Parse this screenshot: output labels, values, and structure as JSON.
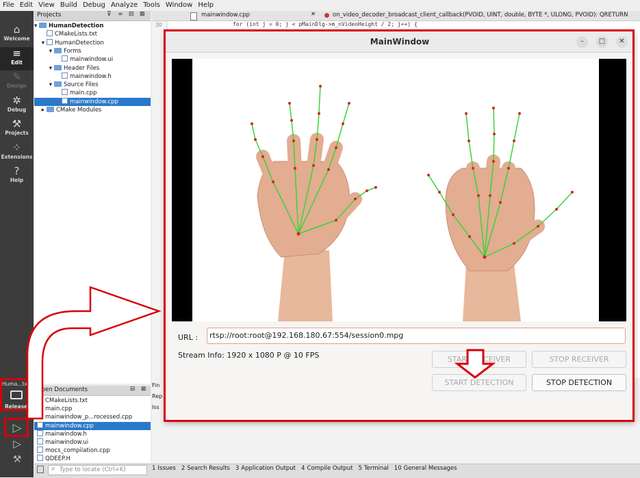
{
  "menu": [
    "File",
    "Edit",
    "View",
    "Build",
    "Debug",
    "Analyze",
    "Tools",
    "Window",
    "Help"
  ],
  "modes": [
    {
      "label": "Welcome",
      "icon": "home-icon",
      "glyph": "⌂",
      "state": "normal"
    },
    {
      "label": "Edit",
      "icon": "edit-icon",
      "glyph": "≡",
      "state": "active"
    },
    {
      "label": "Design",
      "icon": "design-icon",
      "glyph": "✎",
      "state": "disabled"
    },
    {
      "label": "Debug",
      "icon": "debug-icon",
      "glyph": "✲",
      "state": "normal"
    },
    {
      "label": "Projects",
      "icon": "projects-icon",
      "glyph": "⚒",
      "state": "normal"
    },
    {
      "label": "Extensions",
      "icon": "extensions-icon",
      "glyph": "⁘",
      "state": "normal"
    },
    {
      "label": "Help",
      "icon": "help-icon",
      "glyph": "?",
      "state": "normal"
    }
  ],
  "target": {
    "name": "Huma...txn",
    "config": "Release"
  },
  "projects": {
    "title": "Projects",
    "tree": [
      {
        "label": "HumanDetection",
        "depth": 0,
        "kind": "project",
        "bold": true,
        "arrow": "▾"
      },
      {
        "label": "CMakeLists.txt",
        "depth": 1,
        "kind": "cmake",
        "arrow": ""
      },
      {
        "label": "HumanDetection",
        "depth": 1,
        "kind": "target",
        "arrow": "▾"
      },
      {
        "label": "Forms",
        "depth": 2,
        "kind": "folder",
        "arrow": "▾"
      },
      {
        "label": "mainwindow.ui",
        "depth": 3,
        "kind": "ui",
        "arrow": ""
      },
      {
        "label": "Header Files",
        "depth": 2,
        "kind": "folder",
        "arrow": "▾"
      },
      {
        "label": "mainwindow.h",
        "depth": 3,
        "kind": "h",
        "arrow": ""
      },
      {
        "label": "Source Files",
        "depth": 2,
        "kind": "folder",
        "arrow": "▾"
      },
      {
        "label": "main.cpp",
        "depth": 3,
        "kind": "cpp",
        "arrow": ""
      },
      {
        "label": "mainwindow.cpp",
        "depth": 3,
        "kind": "cpp",
        "arrow": "",
        "selected": true
      },
      {
        "label": "CMake Modules",
        "depth": 1,
        "kind": "folder",
        "arrow": "▸"
      }
    ]
  },
  "open_docs": {
    "title": "Open Documents",
    "items": [
      {
        "label": "CMakeLists.txt"
      },
      {
        "label": "main.cpp"
      },
      {
        "label": "mainwindow_p...rocessed.cpp"
      },
      {
        "label": "mainwindow.cpp",
        "selected": true
      },
      {
        "label": "mainwindow.h"
      },
      {
        "label": "mainwindow.ui"
      },
      {
        "label": "mocs_compilation.cpp"
      },
      {
        "label": "QDEEP.H"
      }
    ]
  },
  "editor": {
    "file_tab": "mainwindow.cpp",
    "function": "on_video_decoder_broadcast_client_callback(PVOID, UINT, double, BYTE *, ULONG, PVOID): QRETURN",
    "line_no": "30",
    "code_line": "for (int j = 0; j < pMainDlg->m_nVideoHeight / 2; j++) {"
  },
  "output_tabs": [
    "Fin",
    "Rep",
    "Iss"
  ],
  "status_tabs": [
    {
      "num": "1",
      "label": "Issues"
    },
    {
      "num": "2",
      "label": "Search Results"
    },
    {
      "num": "3",
      "label": "Application Output"
    },
    {
      "num": "4",
      "label": "Compile Output"
    },
    {
      "num": "5",
      "label": "Terminal"
    },
    {
      "num": "10",
      "label": "General Messages"
    }
  ],
  "locate_placeholder": "Type to locate (Ctrl+K)",
  "mainwindow": {
    "title": "MainWindow",
    "url_label": "URL :",
    "url_value": "rtsp://root:root@192.168.180.67:554/session0.mpg",
    "stream_info": "Stream Info: 1920 x 1080 P  @ 10 FPS",
    "buttons": {
      "start_receiver": "START RECEIVER",
      "stop_receiver": "STOP RECEIVER",
      "start_detection": "START DETECTION",
      "stop_detection": "STOP DETECTION"
    }
  },
  "colors": {
    "annotation_red": "#d8000a",
    "skeleton_green": "#3cd23c",
    "keypoint_red": "#e02020",
    "selection_blue": "#2a79c9"
  }
}
